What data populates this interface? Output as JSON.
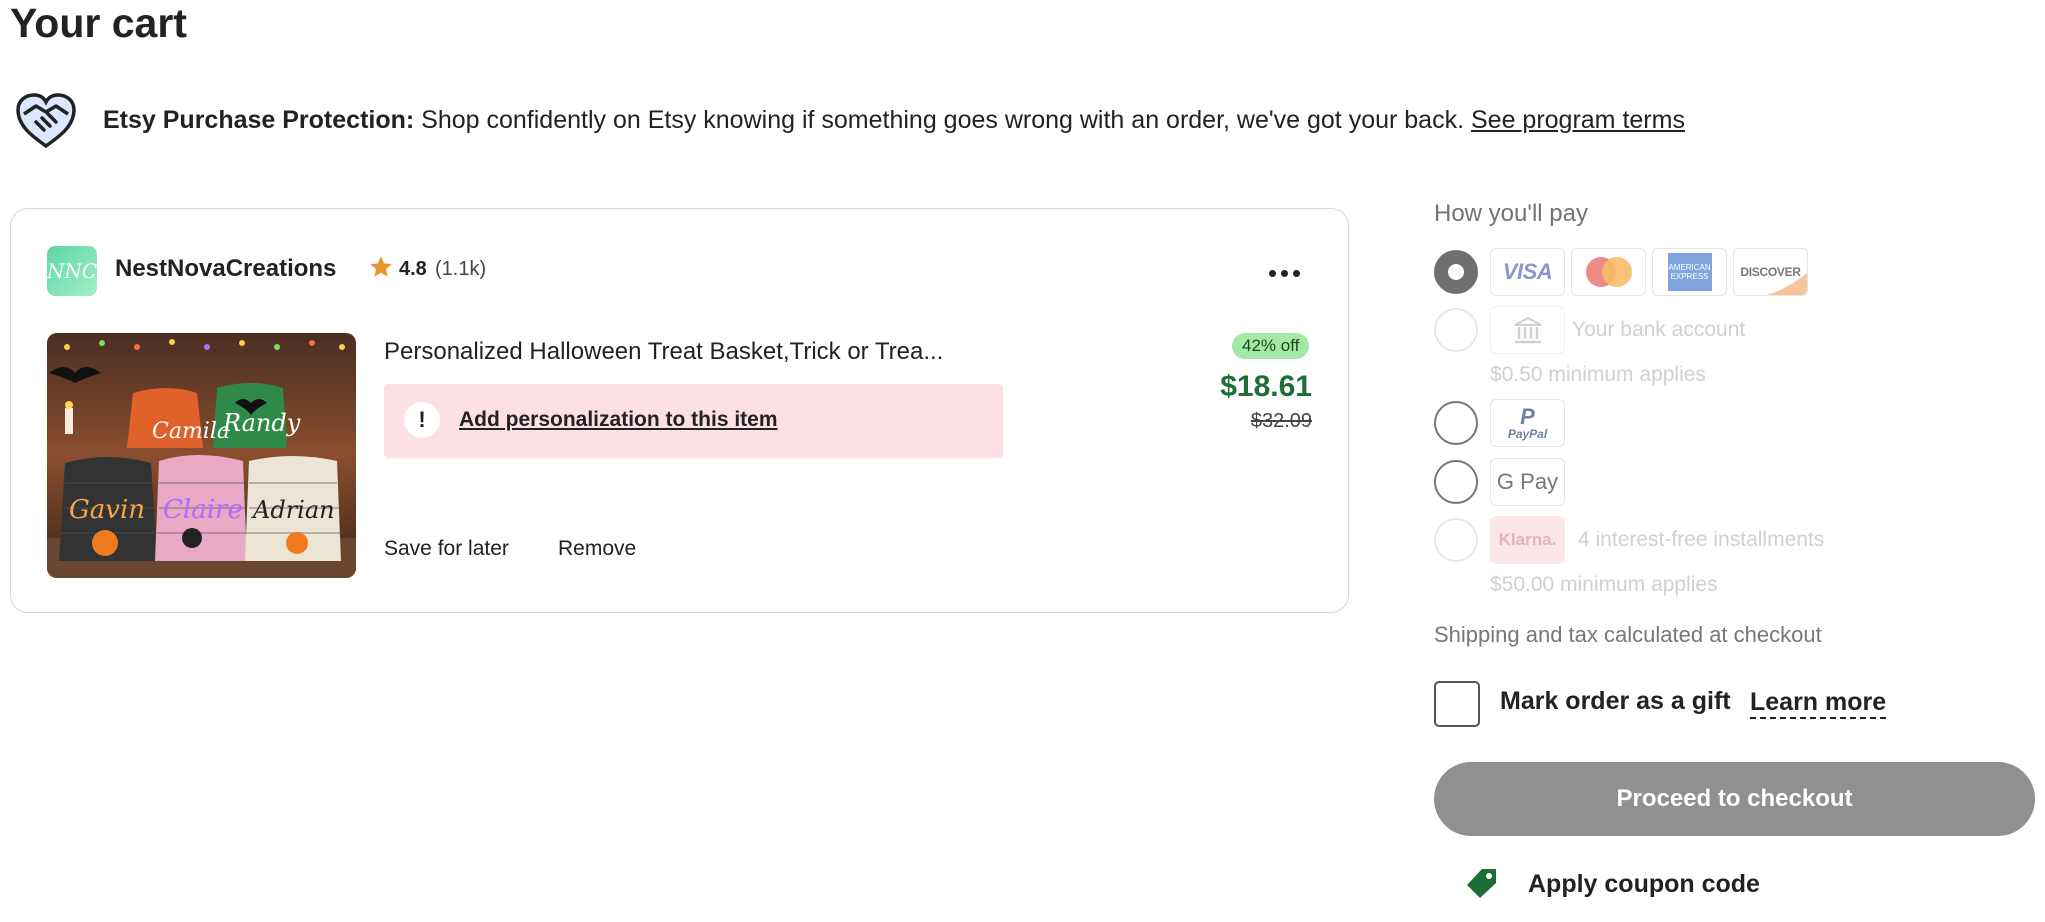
{
  "page": {
    "title": "Your cart"
  },
  "protection": {
    "label": "Etsy Purchase Protection:",
    "text": " Shop confidently on Etsy knowing if something goes wrong with an order, we've got your back. ",
    "link": "See program terms"
  },
  "shop": {
    "logo_text": "NNC",
    "name": "NestNovaCreations",
    "rating": "4.8",
    "rating_count": "(1.1k)"
  },
  "item": {
    "title": "Personalized Halloween Treat Basket,Trick or Trea...",
    "personalization_link": "Add personalization to this item",
    "save_later": "Save for later",
    "remove": "Remove",
    "discount_badge": "42% off",
    "price": "$18.61",
    "original_price": "$32.09",
    "image_names": [
      "Gavin",
      "Claire",
      "Adrian",
      "Camila",
      "Randy"
    ]
  },
  "payment": {
    "heading": "How you'll pay",
    "cards": [
      "VISA",
      "Mastercard",
      "AMERICAN EXPRESS",
      "DISCOVER"
    ],
    "bank": {
      "label": "Your bank account",
      "note": "$0.50 minimum applies"
    },
    "paypal": "PayPal",
    "gpay": "G Pay",
    "klarna": {
      "logo": "Klarna.",
      "label": "4 interest-free installments",
      "note": "$50.00 minimum applies"
    },
    "selected": "cards"
  },
  "summary": {
    "shipping_note": "Shipping and tax calculated at checkout",
    "gift_label": "Mark order as a gift",
    "learn_more": "Learn more",
    "checkout": "Proceed to checkout",
    "coupon": "Apply coupon code"
  },
  "colors": {
    "price_green": "#1b6e35",
    "badge_green": "#a4e8a6",
    "personalization_bg": "#fde0e6",
    "checkout_button": "#909090",
    "coupon_tag": "#1b6e35"
  },
  "icons": [
    "handshake-heart-icon",
    "star-icon",
    "more-dots-icon",
    "exclamation-icon",
    "bank-icon",
    "coupon-tag-icon"
  ]
}
